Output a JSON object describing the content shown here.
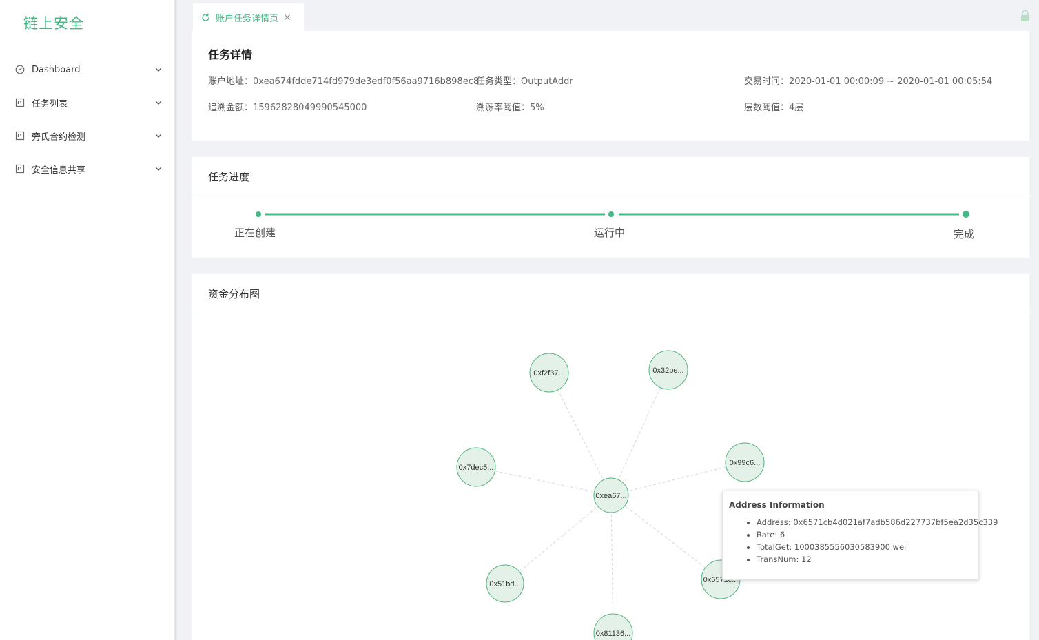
{
  "sidebar": {
    "logo": "链上安全",
    "items": [
      {
        "label": "Dashboard",
        "icon": "dashboard-icon"
      },
      {
        "label": "任务列表",
        "icon": "form-icon"
      },
      {
        "label": "旁氏合约检测",
        "icon": "form-icon"
      },
      {
        "label": "安全信息共享",
        "icon": "form-icon"
      }
    ]
  },
  "tabs": [
    {
      "label": "账户任务详情页",
      "icon": "refresh-icon",
      "active": true
    }
  ],
  "detail": {
    "title": "任务详情",
    "fields": {
      "address": {
        "label": "账户地址：",
        "value": "0xea674fdde714fd979de3edf0f56aa9716b898ec8"
      },
      "task_type": {
        "label": "任务类型：",
        "value": "OutputAddr"
      },
      "trade_time": {
        "label": "交易时间：",
        "value": "2020-01-01 00:00:09 ~ 2020-01-01 00:05:54"
      },
      "amount": {
        "label": "追溯金额：",
        "value": "15962828049990545000"
      },
      "rate_threshold": {
        "label": "溯源率阈值：",
        "value": "5%"
      },
      "layer_threshold": {
        "label": "层数阈值：",
        "value": "4层"
      }
    }
  },
  "progress": {
    "title": "任务进度",
    "steps": [
      "正在创建",
      "运行中",
      "完成"
    ],
    "current_step": 3,
    "accent": "#42b983"
  },
  "graph": {
    "title": "资金分布图",
    "center": {
      "label": "0xea67..."
    },
    "nodes": [
      {
        "label": "0xf2f37..."
      },
      {
        "label": "0x32be..."
      },
      {
        "label": "0x7dec5..."
      },
      {
        "label": "0x99c6..."
      },
      {
        "label": "0x51bd..."
      },
      {
        "label": "0x6571c..."
      },
      {
        "label": "0x81136..."
      }
    ]
  },
  "tooltip": {
    "title": "Address Information",
    "items": [
      "Address: 0x6571cb4d021af7adb586d227737bf5ea2d35c339",
      "Rate: 6",
      "TotalGet: 1000385556030583900 wei",
      "TransNum: 12"
    ]
  },
  "colors": {
    "accent": "#42b983",
    "node_fill": "#e3f1e8",
    "node_stroke": "#52b27e"
  }
}
